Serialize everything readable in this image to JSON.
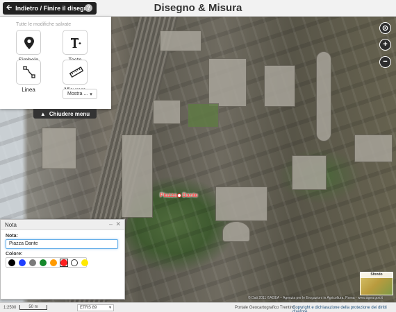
{
  "header": {
    "back_label": "Indietro / Finire il disegno",
    "help_glyph": "?",
    "title": "Disegno & Misura"
  },
  "tools": {
    "saved_text": "Tutte le modifiche salvate",
    "items": [
      {
        "label": "Simbolo",
        "icon": "map-pin-icon"
      },
      {
        "label": "Testo",
        "icon": "text-tool-icon"
      },
      {
        "label": "Linea",
        "icon": "line-tool-icon"
      },
      {
        "label": "Misurare",
        "icon": "ruler-icon"
      }
    ],
    "more_label": "Mostra ...",
    "close_menu_label": "Chiudere menu"
  },
  "map_controls": {
    "locate_icon": "locate-icon",
    "zoom_in": "+",
    "zoom_out": "−"
  },
  "map": {
    "place_label_left": "Piazza",
    "place_label_right": "Dante",
    "credit": "© Dati 2011 ©AGEA – Agenzia per le Erogazioni in Agricoltura, Roma - www.agea.gov.it",
    "minimap_label": "Sfondo"
  },
  "note_panel": {
    "title": "Nota",
    "field_label": "Nota:",
    "field_value": "Piazza Dante",
    "color_label": "Colore:",
    "colors": [
      "#000000",
      "#1f3fff",
      "#7a7a7a",
      "#15882a",
      "#ff9a00",
      "#ff2020",
      "#ffffff",
      "#ffe900"
    ],
    "selected_color_index": 5
  },
  "footer": {
    "scale": "1:2500",
    "scalebar_label": "50 m",
    "crs": "ETRS 89",
    "portal": "Portale Geocartografico Trentino",
    "copyright": "Copyright e dichiarazione della protezione dei diritti d'autore"
  }
}
